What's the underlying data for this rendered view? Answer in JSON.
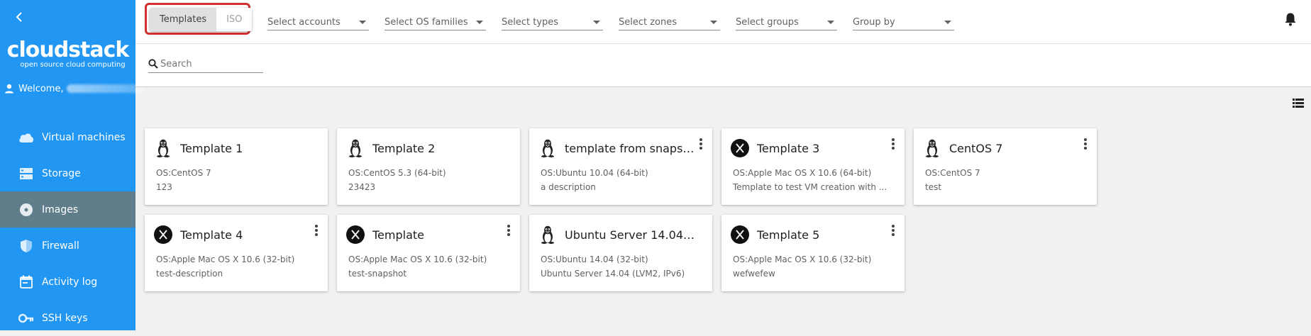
{
  "sidebar": {
    "logo_name": "cloudstack",
    "logo_tagline": "open source cloud computing",
    "welcome": "Welcome,",
    "items": [
      {
        "label": "Virtual machines",
        "icon": "cloud-icon"
      },
      {
        "label": "Storage",
        "icon": "storage-icon"
      },
      {
        "label": "Images",
        "icon": "disc-icon",
        "active": true
      },
      {
        "label": "Firewall",
        "icon": "shield-icon"
      },
      {
        "label": "Activity log",
        "icon": "calendar-icon"
      },
      {
        "label": "SSH keys",
        "icon": "key-icon"
      }
    ]
  },
  "toolbar": {
    "templates_label": "Templates",
    "iso_label": "ISO",
    "filters": [
      "Select accounts",
      "Select OS families",
      "Select types",
      "Select zones",
      "Select groups",
      "Group by"
    ]
  },
  "search": {
    "placeholder": "Search"
  },
  "cards": [
    {
      "name": "Template 1",
      "os": "OS:CentOS 7",
      "desc": "123",
      "icon": "linux"
    },
    {
      "name": "Template 2",
      "os": "OS:CentOS 5.3 (64-bit)",
      "desc": "23423",
      "icon": "linux"
    },
    {
      "name": "template from snapshot",
      "os": "OS:Ubuntu 10.04 (64-bit)",
      "desc": "a description",
      "icon": "linux"
    },
    {
      "name": "Template 3",
      "os": "OS:Apple Mac OS X 10.6 (64-bit)",
      "desc": "Template to test VM creation with ...",
      "icon": "mac"
    },
    {
      "name": "CentOS 7",
      "os": "OS:CentOS 7",
      "desc": "test",
      "icon": "linux"
    },
    {
      "name": "Template 4",
      "os": "OS:Apple Mac OS X 10.6 (32-bit)",
      "desc": "test-description",
      "icon": "mac"
    },
    {
      "name": "Template",
      "os": "OS:Apple Mac OS X 10.6 (32-bit)",
      "desc": "test-snapshot",
      "icon": "mac"
    },
    {
      "name": "Ubuntu Server 14.04 (...",
      "os": "OS:Ubuntu 14.04 (32-bit)",
      "desc": "Ubuntu Server 14.04 (LVM2, IPv6)",
      "icon": "linux"
    },
    {
      "name": "Template 5",
      "os": "OS:Apple Mac OS X 10.6 (32-bit)",
      "desc": "wefwefew",
      "icon": "mac"
    }
  ],
  "colors": {
    "sidebar": "#2196f3",
    "sidebar_active": "#607d8b",
    "highlight": "#d32f2f"
  }
}
